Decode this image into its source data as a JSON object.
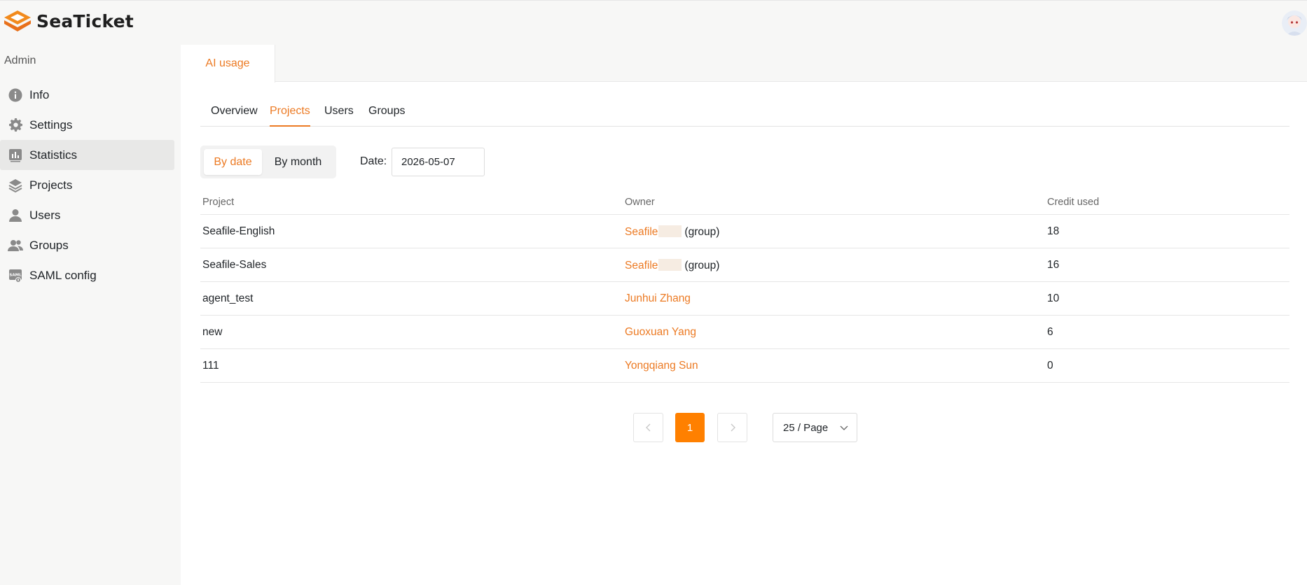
{
  "app": {
    "name": "SeaTicket",
    "brand_color": "#ec7a23"
  },
  "sidebar": {
    "heading": "Admin",
    "items": [
      {
        "label": "Info",
        "icon": "info-icon"
      },
      {
        "label": "Settings",
        "icon": "gear-icon"
      },
      {
        "label": "Statistics",
        "icon": "chart-icon",
        "active": true
      },
      {
        "label": "Projects",
        "icon": "layers-icon"
      },
      {
        "label": "Users",
        "icon": "user-icon"
      },
      {
        "label": "Groups",
        "icon": "group-icon"
      },
      {
        "label": "SAML config",
        "icon": "saml-icon"
      }
    ]
  },
  "page_tabs": [
    {
      "label": "AI usage",
      "active": true
    }
  ],
  "sub_tabs": [
    {
      "label": "Overview"
    },
    {
      "label": "Projects",
      "active": true
    },
    {
      "label": "Users"
    },
    {
      "label": "Groups"
    }
  ],
  "filter": {
    "modes": [
      {
        "label": "By date",
        "active": true
      },
      {
        "label": "By month"
      }
    ],
    "date_label": "Date:",
    "date_value": "2026-05-07"
  },
  "table": {
    "columns": [
      "Project",
      "Owner",
      "Credit used"
    ],
    "rows": [
      {
        "project": "Seafile-English",
        "owner": "Seafile",
        "owner_suffix": "(group)",
        "redacted": true,
        "credit": "18"
      },
      {
        "project": "Seafile-Sales",
        "owner": "Seafile",
        "owner_suffix": "(group)",
        "redacted": true,
        "credit": "16"
      },
      {
        "project": "agent_test",
        "owner": "Junhui Zhang",
        "owner_suffix": "",
        "redacted": false,
        "credit": "10"
      },
      {
        "project": "new",
        "owner": "Guoxuan Yang",
        "owner_suffix": "",
        "redacted": false,
        "credit": "6"
      },
      {
        "project": "111",
        "owner": "Yongqiang Sun",
        "owner_suffix": "",
        "redacted": false,
        "credit": "0"
      }
    ]
  },
  "pagination": {
    "current_page": "1",
    "page_size": "25 / Page"
  }
}
